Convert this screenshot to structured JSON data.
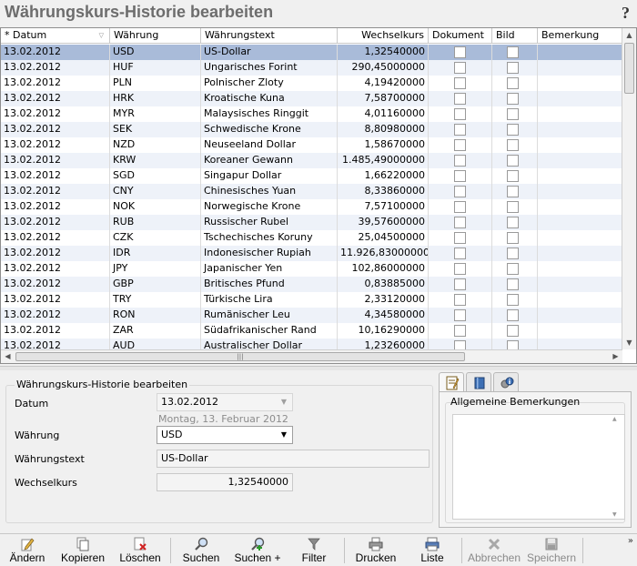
{
  "window": {
    "title": "Währungskurs-Historie bearbeiten",
    "help_glyph": "?"
  },
  "grid": {
    "columns": [
      {
        "label": "* Datum",
        "sort_glyph": "▽"
      },
      {
        "label": "Währung"
      },
      {
        "label": "Währungstext"
      },
      {
        "label": "Wechselkurs"
      },
      {
        "label": "Dokument"
      },
      {
        "label": "Bild"
      },
      {
        "label": "Bemerkung"
      }
    ],
    "rows": [
      {
        "datum": "13.02.2012",
        "code": "USD",
        "text": "US-Dollar",
        "kurs": "1,32540000"
      },
      {
        "datum": "13.02.2012",
        "code": "HUF",
        "text": "Ungarisches Forint",
        "kurs": "290,45000000"
      },
      {
        "datum": "13.02.2012",
        "code": "PLN",
        "text": "Polnischer Zloty",
        "kurs": "4,19420000"
      },
      {
        "datum": "13.02.2012",
        "code": "HRK",
        "text": "Kroatische Kuna",
        "kurs": "7,58700000"
      },
      {
        "datum": "13.02.2012",
        "code": "MYR",
        "text": "Malaysisches Ringgit",
        "kurs": "4,01160000"
      },
      {
        "datum": "13.02.2012",
        "code": "SEK",
        "text": "Schwedische Krone",
        "kurs": "8,80980000"
      },
      {
        "datum": "13.02.2012",
        "code": "NZD",
        "text": "Neuseeland Dollar",
        "kurs": "1,58670000"
      },
      {
        "datum": "13.02.2012",
        "code": "KRW",
        "text": "Koreaner Gewann",
        "kurs": "1.485,49000000"
      },
      {
        "datum": "13.02.2012",
        "code": "SGD",
        "text": "Singapur Dollar",
        "kurs": "1,66220000"
      },
      {
        "datum": "13.02.2012",
        "code": "CNY",
        "text": "Chinesisches Yuan",
        "kurs": "8,33860000"
      },
      {
        "datum": "13.02.2012",
        "code": "NOK",
        "text": "Norwegische Krone",
        "kurs": "7,57100000"
      },
      {
        "datum": "13.02.2012",
        "code": "RUB",
        "text": "Russischer Rubel",
        "kurs": "39,57600000"
      },
      {
        "datum": "13.02.2012",
        "code": "CZK",
        "text": "Tschechisches Koruny",
        "kurs": "25,04500000"
      },
      {
        "datum": "13.02.2012",
        "code": "IDR",
        "text": "Indonesischer Rupiah",
        "kurs": "11.926,83000000"
      },
      {
        "datum": "13.02.2012",
        "code": "JPY",
        "text": "Japanischer Yen",
        "kurs": "102,86000000"
      },
      {
        "datum": "13.02.2012",
        "code": "GBP",
        "text": "Britisches Pfund",
        "kurs": "0,83885000"
      },
      {
        "datum": "13.02.2012",
        "code": "TRY",
        "text": "Türkische Lira",
        "kurs": "2,33120000"
      },
      {
        "datum": "13.02.2012",
        "code": "RON",
        "text": "Rumänischer Leu",
        "kurs": "4,34580000"
      },
      {
        "datum": "13.02.2012",
        "code": "ZAR",
        "text": "Südafrikanischer Rand",
        "kurs": "10,16290000"
      },
      {
        "datum": "13.02.2012",
        "code": "AUD",
        "text": "Australischer Dollar",
        "kurs": "1,23260000"
      }
    ],
    "selected_index": 0,
    "hscroll_grip": "|||"
  },
  "form": {
    "legend": "Währungskurs-Historie bearbeiten",
    "datum_label": "Datum",
    "datum_value": "13.02.2012",
    "datum_long": "Montag, 13. Februar 2012",
    "waehrung_label": "Währung",
    "waehrung_value": "USD",
    "text_label": "Währungstext",
    "text_value": "US-Dollar",
    "kurs_label": "Wechselkurs",
    "kurs_value": "1,32540000"
  },
  "notes": {
    "legend": "Allgemeine Bemerkungen",
    "value": ""
  },
  "toolbar": {
    "aendern": "Ändern",
    "kopieren": "Kopieren",
    "loeschen": "Löschen",
    "suchen": "Suchen",
    "suchen_plus": "Suchen +",
    "filter": "Filter",
    "drucken": "Drucken",
    "liste": "Liste",
    "abbrechen": "Abbrechen",
    "speichern": "Speichern",
    "more": "»"
  },
  "colors": {
    "selected_row": "#a9bbd9",
    "alt_row": "#eef2f9",
    "title_text": "#6d6d6d"
  }
}
